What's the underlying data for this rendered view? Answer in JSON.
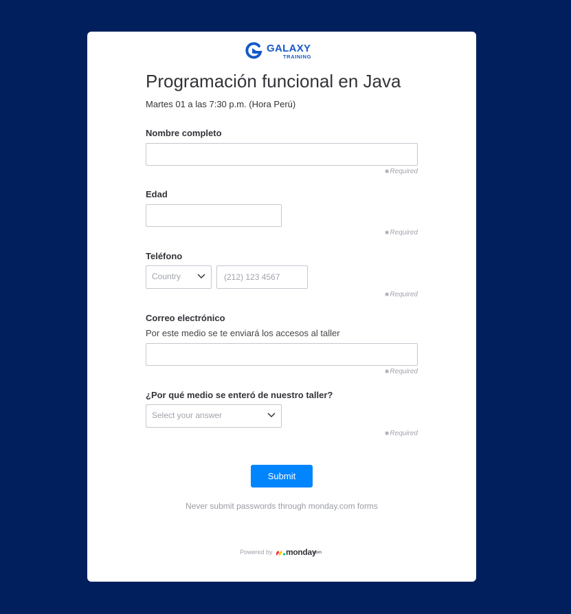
{
  "logo": {
    "word": "GALAXY",
    "sub": "TRAINING",
    "icon": "galaxy-logo-icon",
    "color": "#1559c9"
  },
  "form": {
    "title": "Programación funcional en Java",
    "subtitle": "Martes 01 a las 7:30 p.m. (Hora Perú)",
    "required_text": "Required",
    "fields": {
      "name": {
        "label": "Nombre completo",
        "value": ""
      },
      "age": {
        "label": "Edad",
        "value": ""
      },
      "phone": {
        "label": "Teléfono",
        "country_placeholder": "Country",
        "number_placeholder": "(212) 123 4567",
        "value": ""
      },
      "email": {
        "label": "Correo electrónico",
        "description": "Por este medio se te enviará los accesos al taller",
        "value": ""
      },
      "source": {
        "label": "¿Por qué medio se enteró de nuestro taller?",
        "placeholder": "Select your answer"
      }
    },
    "submit_label": "Submit",
    "password_note": "Never submit passwords through monday.com forms",
    "powered_by": "Powered by",
    "brand": {
      "name": "monday",
      "suffix": ".com"
    }
  },
  "colors": {
    "background": "#001f5c",
    "card": "#ffffff",
    "accent": "#0085ff",
    "text": "#323338"
  }
}
